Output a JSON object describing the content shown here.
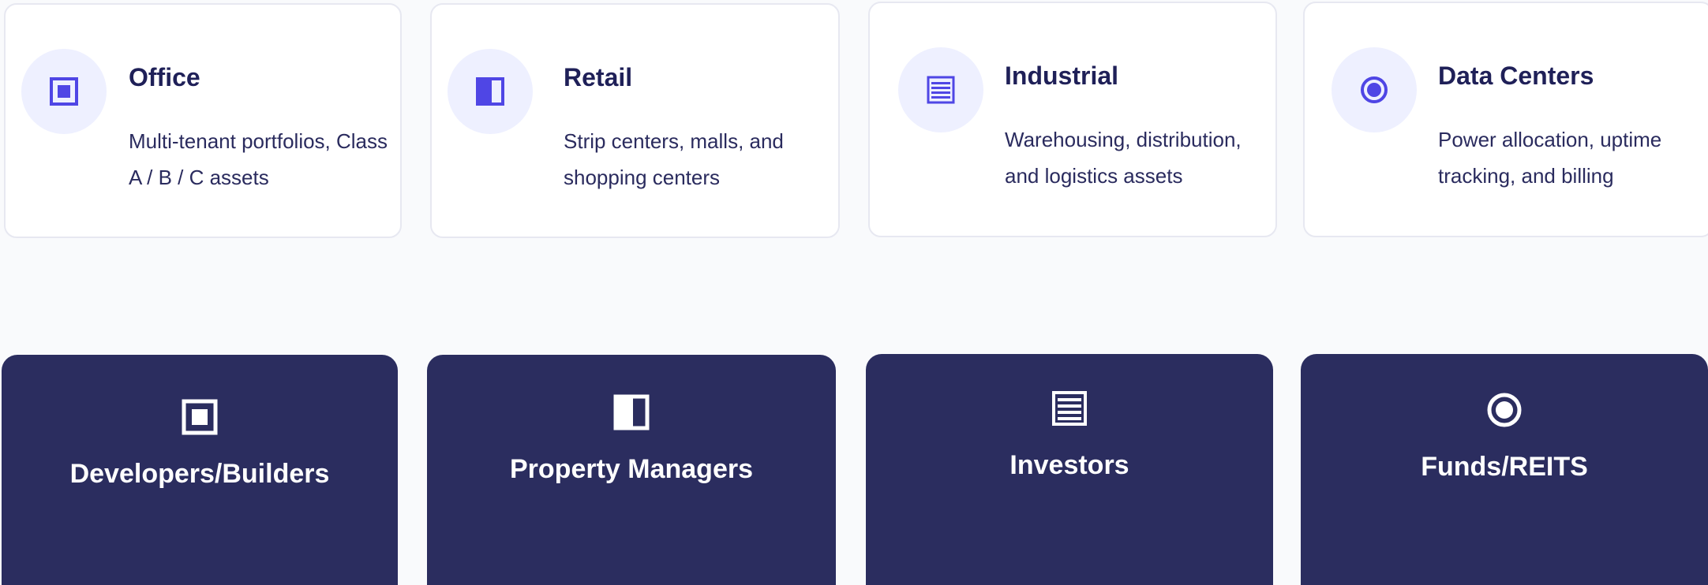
{
  "colors": {
    "page_background": "#f9fafc",
    "card_background": "#ffffff",
    "card_border": "#e7e8f1",
    "icon_circle": "#eef0ff",
    "accent": "#4f46e5",
    "heading_text": "#1f2058",
    "body_text": "#2a2b5e",
    "audience_card": "#2b2d5f",
    "audience_text": "#ffffff"
  },
  "asset_types": [
    {
      "title": "Office",
      "description": "Multi-tenant portfolios, Class A / B / C assets",
      "icon": "office-square-icon"
    },
    {
      "title": "Retail",
      "description": "Strip centers, malls, and shopping centers",
      "icon": "retail-half-square-icon"
    },
    {
      "title": "Industrial",
      "description": "Warehousing, distribution, and logistics assets",
      "icon": "industrial-lines-icon"
    },
    {
      "title": "Data Centers",
      "description": "Power allocation, uptime tracking, and billing",
      "icon": "data-center-target-icon"
    }
  ],
  "audiences": [
    {
      "label": "Developers/Builders",
      "icon": "office-square-icon"
    },
    {
      "label": "Property Managers",
      "icon": "retail-half-square-icon"
    },
    {
      "label": "Investors",
      "icon": "industrial-lines-icon"
    },
    {
      "label": "Funds/REITS",
      "icon": "data-center-target-icon"
    }
  ]
}
